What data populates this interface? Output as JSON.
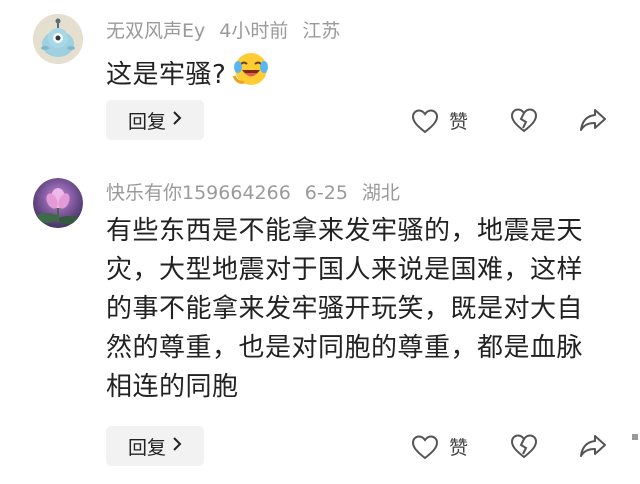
{
  "comments": [
    {
      "username": "无双风声Ey",
      "time": "4小时前",
      "location": "江苏",
      "text": "这是牢骚?",
      "emoji": "laughing-crying-emoji",
      "reply_label": "回复",
      "like_label": "赞"
    },
    {
      "username": "快乐有你159664266",
      "time": "6-25",
      "location": "湖北",
      "text": "有些东西是不能拿来发牢骚的，地震是天灾，大型地震对于国人来说是国难，这样的事不能拿来发牢骚开玩笑，既是对大自然的尊重，也是对同胞的尊重，都是血脉相连的同胞",
      "reply_label": "回复",
      "like_label": "赞"
    }
  ],
  "colors": {
    "meta": "#9a9a9a",
    "text": "#222222",
    "reply_bg": "#f2f2f2",
    "icon": "#555555"
  },
  "icons": {
    "like": "heart-outline-icon",
    "dislike": "broken-heart-icon",
    "share": "share-arrow-icon",
    "reply_chevron": "chevron-right-icon"
  }
}
